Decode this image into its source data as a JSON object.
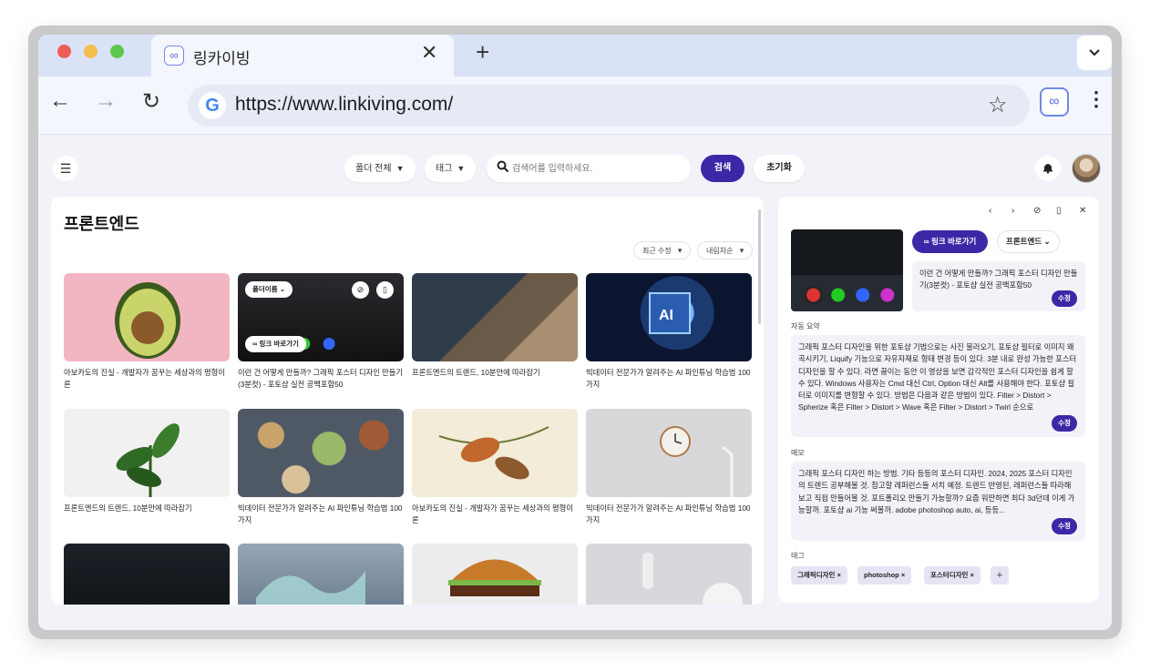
{
  "browser": {
    "tab_title": "링카이빙",
    "tab_close": "✕",
    "new_tab": "+",
    "tab_menu": "⌄",
    "url": "https://www.linkiving.com/",
    "nav": {
      "back": "←",
      "forward": "→",
      "reload": "↻"
    },
    "star": "☆",
    "kebab": "⋮",
    "google_letter": "G"
  },
  "topbar": {
    "menu_icon": "☰",
    "folder_filter": "폴더 전체",
    "tag_filter": "태그",
    "search_placeholder": "검색어를 입력하세요.",
    "search_button": "검색",
    "reset_button": "초기화",
    "bell_icon": "🔔"
  },
  "main": {
    "title": "프론트엔드",
    "sort_recent": "최근 수정",
    "sort_order": "내림차순",
    "hover_overlay": {
      "folder": "폴더이름",
      "link": "링크 바로가기"
    },
    "cards": [
      {
        "title": "아보카도의 진실 - 개발자가 꿈꾸는 세상과의 평형이론"
      },
      {
        "title": "이런 건 어떻게 만들까? 그래픽 포스터 디자인 만들기(3분컷) - 포토샵 실전 공백포함50"
      },
      {
        "title": "프론트엔드의 트렌드, 10분만에 따라잡기"
      },
      {
        "title": "빅데이터 전문가가 알려주는 AI 파인튜닝 학습법 100가지"
      },
      {
        "title": "프론트엔드의 트렌드, 10분만에 따라잡기"
      },
      {
        "title": "빅데이터 전문가가 알려주는 AI 파인튜닝 학습법 100가지"
      },
      {
        "title": "아보카도의 진실 - 개발자가 꿈꾸는 세상과의 평형이론"
      },
      {
        "title": "빅데이터 전문가가 알려주는 AI 파인튜닝 학습법 100가지"
      },
      {
        "title": ""
      },
      {
        "title": ""
      },
      {
        "title": ""
      },
      {
        "title": ""
      }
    ]
  },
  "detail": {
    "controls": {
      "prev": "‹",
      "next": "›",
      "unpin": "⊘",
      "delete": "🗑",
      "close": "✕"
    },
    "goto_button": "링크 바로가기",
    "folder_select": "프론트엔드",
    "title_text": "이런 건 어떻게 만들까? 그래픽 포스터 디자인 만들기(3분컷) - 포토샵 실전 공백포함50",
    "summary_label": "자동 요약",
    "summary_text": "그래픽 포스터 디자인을 위한 포토샵 기법으로는 사진 불러오기, 포토샵 필터로 이미지 왜곡시키기, Liquify 기능으로 자유자재로 형태 변경 등이 있다. 3분 내로 완성 가능한 포스터 디자인을 할 수 있다. 라면 끓이는 동안 이 영상을 보면 감각적인 포스터 디자인을 쉽게 할 수 있다. Windows 사용자는 Cmd 대신 Ctrl, Option 대신 Alt를 사용해야 한다. 포토샵 필터로 이미지를 변형할 수 있다. 방법은 다음과 같은 방법이 있다. Filter > Distort > Spherize 혹은 Filter > Distort > Wave 혹은 Filter > Distort > Twirl 순으로",
    "memo_label": "메모",
    "memo_text": "그래픽 포스터 디자인 하는 방법. 기타 등등의 포스터 디자인. 2024, 2025 포스터 디자인의 트렌드 공부해볼 것. 참고할 레퍼런스들 서치 예정. 트렌드 반영된, 레퍼런스들 따라해보고 직접 만들어볼 것. 포트폴리오 만들기 가능할까? 요즘 워딴하면 최다 3d던데 이게 가능할까. 포토샵 ai 기능 써볼까. adobe photoshop auto, ai, 등등...",
    "edit_label": "수정",
    "tags_label": "태그",
    "tags": [
      "그래픽디자인",
      "photoshop",
      "포스터디자인"
    ],
    "tag_remove": "×",
    "tag_add": "+"
  },
  "colors": {
    "accent": "#3d27a6",
    "tabstrip": "#dae3f6",
    "app_bg": "#f2f3f8",
    "tag_bg": "#e6e4f4"
  }
}
